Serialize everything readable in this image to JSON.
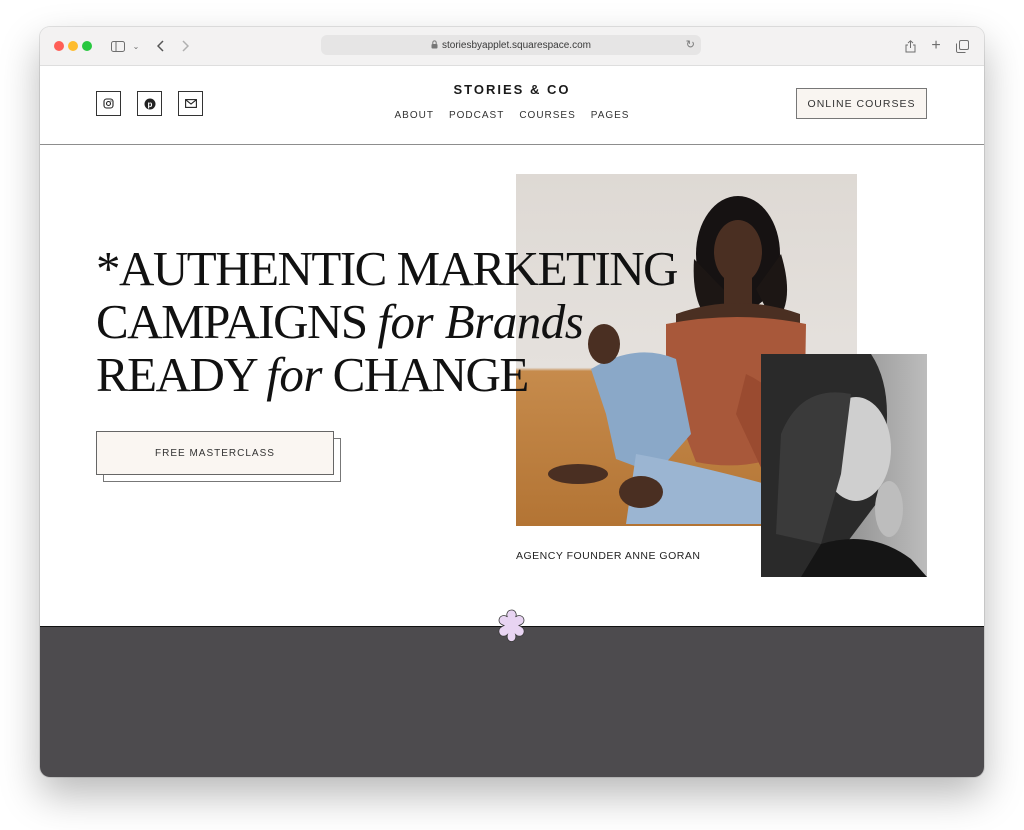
{
  "browser": {
    "url": "storiesbyapplet.squarespace.com",
    "icons": [
      "sidebar-icon",
      "chevron-down-icon",
      "back-icon",
      "forward-icon",
      "lock-icon",
      "reload-icon",
      "share-icon",
      "plus-icon",
      "tabs-icon"
    ]
  },
  "header": {
    "brand": "STORIES & CO",
    "nav": [
      "ABOUT",
      "PODCAST",
      "COURSES",
      "PAGES"
    ],
    "cta": "ONLINE COURSES",
    "social": [
      "instagram-icon",
      "pinterest-icon",
      "mail-icon"
    ]
  },
  "hero": {
    "line1": "*AUTHENTIC MARKETING",
    "line2_a": "CAMPAIGNS ",
    "line2_b": "for Brands",
    "line3_a": "READY ",
    "line3_b": "for",
    "line3_c": " CHANGE",
    "button": "FREE MASTERCLASS",
    "caption": "AGENCY FOUNDER ANNE GORAN"
  },
  "colors": {
    "footer": "#4d4b4e",
    "button_bg": "#faf6f2",
    "flower": "#e8d4f2"
  }
}
